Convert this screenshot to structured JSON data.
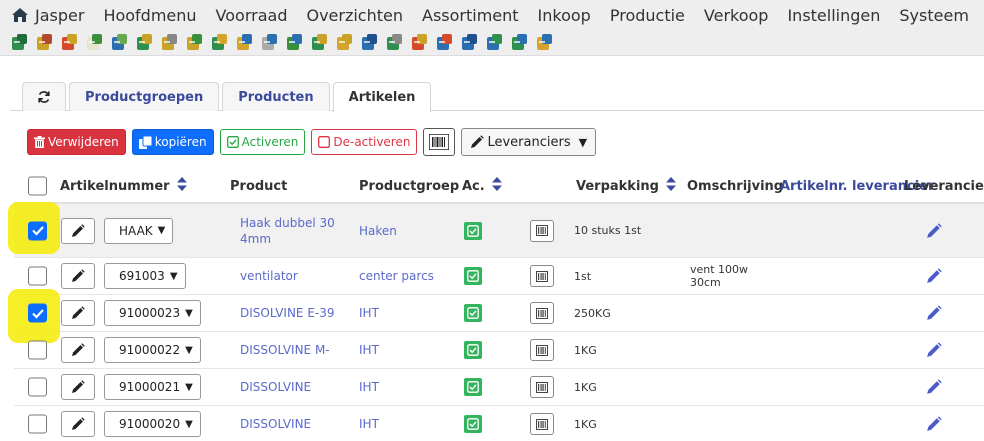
{
  "menu": {
    "home_label": "Jasper",
    "items": [
      "Hoofdmenu",
      "Voorraad",
      "Overzichten",
      "Assortiment",
      "Inkoop",
      "Productie",
      "Verkoop",
      "Instellingen",
      "Systeem"
    ]
  },
  "toolbar": {
    "icons": [
      "module-icon",
      "edit-doc-icon",
      "inventory-icon",
      "note-icon",
      "grid-icon",
      "box-icon",
      "shovel-icon",
      "package-add-icon",
      "package-check-icon",
      "search-icon",
      "zoom-icon",
      "report-icon",
      "doc-check-icon",
      "cube-icon",
      "dispatch-icon",
      "doc-stack-icon",
      "form-icon",
      "doc-edit-icon",
      "cube-blue-icon",
      "cube-arrow-icon",
      "cube-add-icon",
      "user-search-icon"
    ]
  },
  "tabs": {
    "items": [
      "Productgroepen",
      "Producten",
      "Artikelen"
    ],
    "active": "Artikelen"
  },
  "actions": {
    "delete_label": "Verwijderen",
    "copy_label": "kopiëren",
    "activate_label": "Activeren",
    "deactivate_label": "De-activeren",
    "suppliers_label": "Leveranciers"
  },
  "table": {
    "columns": {
      "artikelnummer": "Artikelnummer",
      "product": "Product",
      "productgroep": "Productgroep",
      "actief": "Ac.",
      "verpakking": "Verpakking",
      "omschrijving": "Omschrijving",
      "artikelnr_leverancier": "Artikelnr. leverancier",
      "leverancier": "Leverancier"
    },
    "rows": [
      {
        "artikelnummer": "HAAK",
        "product_line1": "Haak dubbel 30",
        "product_line2": "4mm",
        "productgroep": "Haken",
        "verpakking": "10 stuks 1st",
        "omschrijving_line1": "",
        "omschrijving_line2": "",
        "checked": true
      },
      {
        "artikelnummer": "691003",
        "product_line1": "ventilator",
        "product_line2": "",
        "productgroep": "center parcs",
        "verpakking": "1st",
        "omschrijving_line1": "vent 100w",
        "omschrijving_line2": "30cm",
        "checked": false
      },
      {
        "artikelnummer": "91000023",
        "product_line1": "DISOLVINE E-39",
        "product_line2": "",
        "productgroep": "IHT",
        "verpakking": "250KG",
        "omschrijving_line1": "",
        "omschrijving_line2": "",
        "checked": true
      },
      {
        "artikelnummer": "91000022",
        "product_line1": "DISSOLVINE M-",
        "product_line2": "",
        "productgroep": "IHT",
        "verpakking": "1KG",
        "omschrijving_line1": "",
        "omschrijving_line2": "",
        "checked": false
      },
      {
        "artikelnummer": "91000021",
        "product_line1": "DISSOLVINE",
        "product_line2": "",
        "productgroep": "IHT",
        "verpakking": "1KG",
        "omschrijving_line1": "",
        "omschrijving_line2": "",
        "checked": false
      },
      {
        "artikelnummer": "91000020",
        "product_line1": "DISSOLVINE",
        "product_line2": "",
        "productgroep": "IHT",
        "verpakking": "1KG",
        "omschrijving_line1": "",
        "omschrijving_line2": "",
        "checked": false
      }
    ]
  },
  "colors": {
    "link": "#5b6acb",
    "active_green": "#34b45e",
    "highlight": "#f5eb00",
    "check_blue": "#0d6efd",
    "delete_red": "#d9333f"
  }
}
